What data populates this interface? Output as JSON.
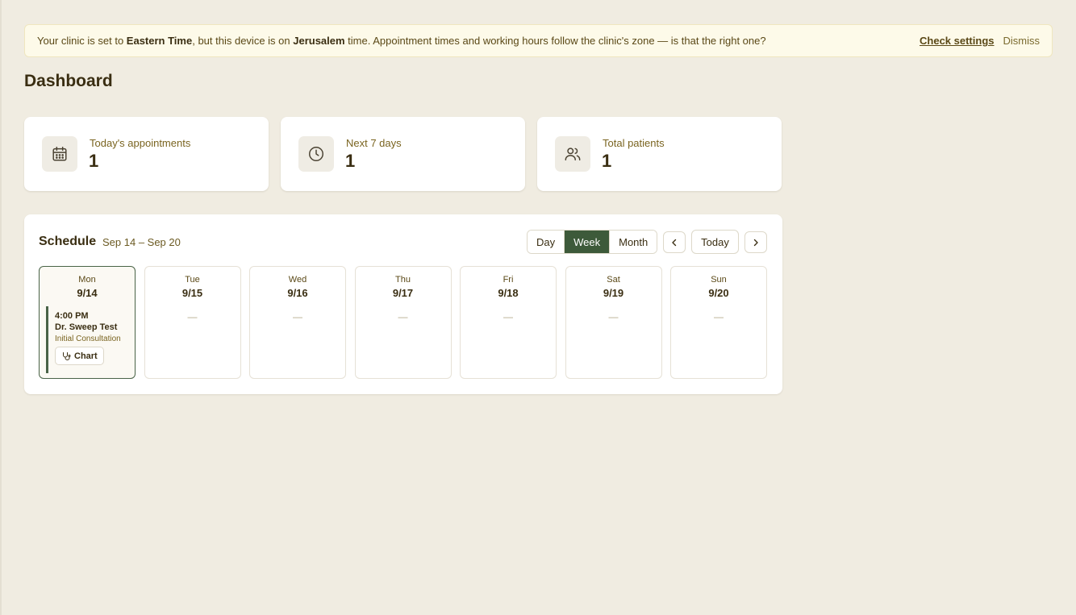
{
  "banner": {
    "msg_prefix": "Your clinic is set to ",
    "clinic_zone": "Eastern Time",
    "msg_middle": ", but this device is on ",
    "device_zone": "Jerusalem",
    "msg_suffix": " time. Appointment times and working hours follow the clinic's zone — is that the right one?",
    "check_settings": "Check settings",
    "dismiss": "Dismiss"
  },
  "page": {
    "title": "Dashboard"
  },
  "stats": [
    {
      "label": "Today's appointments",
      "value": "1",
      "icon": "calendar-icon"
    },
    {
      "label": "Next 7 days",
      "value": "1",
      "icon": "clock-icon"
    },
    {
      "label": "Total patients",
      "value": "1",
      "icon": "users-icon"
    }
  ],
  "schedule": {
    "title": "Schedule",
    "range": "Sep 14 – Sep 20",
    "views": [
      "Day",
      "Week",
      "Month"
    ],
    "active_view": "Week",
    "today_label": "Today",
    "empty_marker": "—",
    "days": [
      {
        "name": "Mon",
        "date": "9/14"
      },
      {
        "name": "Tue",
        "date": "9/15"
      },
      {
        "name": "Wed",
        "date": "9/16"
      },
      {
        "name": "Thu",
        "date": "9/17"
      },
      {
        "name": "Fri",
        "date": "9/18"
      },
      {
        "name": "Sat",
        "date": "9/19"
      },
      {
        "name": "Sun",
        "date": "9/20"
      }
    ],
    "appointment": {
      "time": "4:00 PM",
      "name": "Dr. Sweep Test",
      "type": "Initial Consultation",
      "chart_label": "Chart"
    }
  },
  "colors": {
    "background": "#f0ece1",
    "accent": "#3d5a3a",
    "banner_bg": "#fdfae9",
    "text": "#3a2e12"
  }
}
